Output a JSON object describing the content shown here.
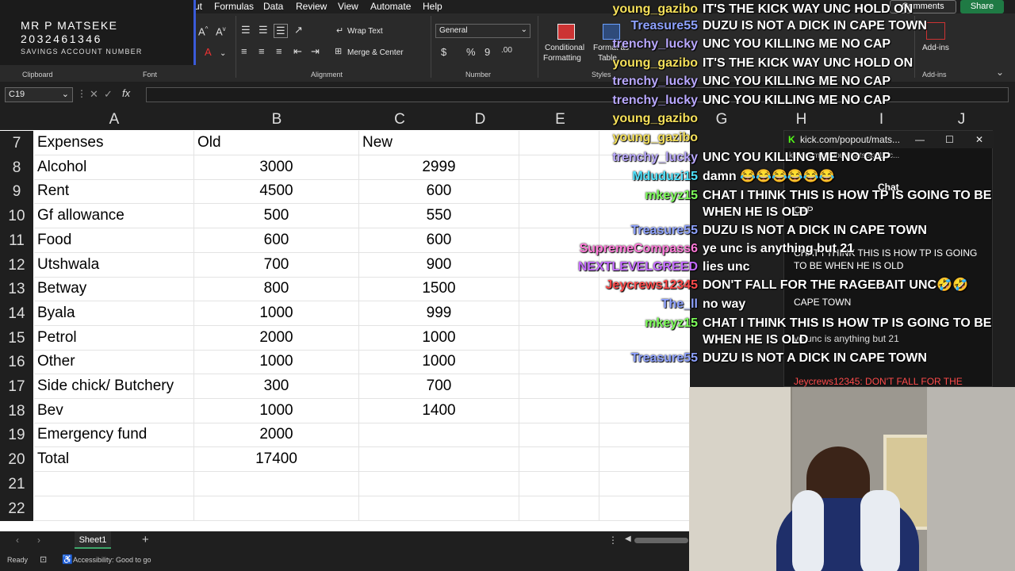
{
  "account": {
    "name": "MR P MATSEKE",
    "number": "2032461346",
    "label": "SAVINGS ACCOUNT NUMBER"
  },
  "menu": [
    "ut",
    "Formulas",
    "Data",
    "Review",
    "View",
    "Automate",
    "Help"
  ],
  "topright": {
    "comments": "Comments",
    "share": "Share"
  },
  "ribbon": {
    "wrap_text": "Wrap Text",
    "merge_center": "Merge & Center",
    "number_format": "General",
    "conditional": "Conditional",
    "formatting": "Formatting",
    "format_as": "Format as",
    "table": "Table",
    "addins": "Add-ins",
    "groups": {
      "clipboard": "Clipboard",
      "font": "Font",
      "alignment": "Alignment",
      "number": "Number",
      "styles": "Styles",
      "addins": "Add-ins"
    }
  },
  "formula_bar": {
    "name_box": "C19",
    "fx": "fx",
    "value": ""
  },
  "columns": [
    "A",
    "B",
    "C",
    "D",
    "E"
  ],
  "rows": [
    {
      "n": "7",
      "a": "Expenses",
      "b": "Old",
      "c": "New",
      "hdr": true
    },
    {
      "n": "8",
      "a": "Alcohol",
      "b": "3000",
      "c": "2999"
    },
    {
      "n": "9",
      "a": "Rent",
      "b": "4500",
      "c": "600"
    },
    {
      "n": "10",
      "a": "Gf allowance",
      "b": "500",
      "c": "550"
    },
    {
      "n": "11",
      "a": "Food",
      "b": "600",
      "c": "600"
    },
    {
      "n": "12",
      "a": "Utshwala",
      "b": "700",
      "c": "900"
    },
    {
      "n": "13",
      "a": "Betway",
      "b": "800",
      "c": "1500"
    },
    {
      "n": "14",
      "a": "Byala",
      "b": "1000",
      "c": "999"
    },
    {
      "n": "15",
      "a": "Petrol",
      "b": "2000",
      "c": "1000"
    },
    {
      "n": "16",
      "a": "Other",
      "b": "1000",
      "c": "1000"
    },
    {
      "n": "17",
      "a": "Side chick/ Butchery",
      "b": "300",
      "c": "700"
    },
    {
      "n": "18",
      "a": "Bev",
      "b": "1000",
      "c": "1400"
    },
    {
      "n": "19",
      "a": "Emergency fund",
      "b": "2000",
      "c": ""
    },
    {
      "n": "20",
      "a": "Total",
      "b": "17400",
      "c": ""
    },
    {
      "n": "21",
      "a": "",
      "b": "",
      "c": ""
    },
    {
      "n": "22",
      "a": "",
      "b": "",
      "c": ""
    }
  ],
  "right_columns": [
    "G",
    "H",
    "I",
    "J"
  ],
  "sheet_tab": "Sheet1",
  "status": {
    "ready": "Ready",
    "accessibility": "Accessibility: Good to go"
  },
  "chat": [
    {
      "user": "young_gazibo",
      "color": "#f5e05a",
      "msg": "IT'S THE KICK WAY UNC HOLD ON"
    },
    {
      "user": "Treasure55",
      "color": "#8ea2ff",
      "msg": "DUZU IS NOT A DICK IN CAPE TOWN"
    },
    {
      "user": "trenchy_lucky",
      "color": "#b9a8ff",
      "msg": "UNC YOU KILLING ME NO CAP"
    },
    {
      "user": "young_gazibo",
      "color": "#f5e05a",
      "msg": "IT'S THE KICK WAY UNC HOLD ON"
    },
    {
      "user": "trenchy_lucky",
      "color": "#b9a8ff",
      "msg": "UNC YOU KILLING ME NO CAP"
    },
    {
      "user": "trenchy_lucky",
      "color": "#b9a8ff",
      "msg": "UNC YOU KILLING ME NO CAP"
    },
    {
      "user": "young_gazibo",
      "color": "#f5e05a",
      "msg": ""
    },
    {
      "user": "young_gazibo",
      "color": "#f5e05a",
      "msg": ""
    },
    {
      "user": "trenchy_lucky",
      "color": "#b9a8ff",
      "msg": "UNC YOU KILLING ME NO CAP"
    },
    {
      "user": "Mduduzi15",
      "color": "#4fe3ff",
      "msg": "damn 😂😂😂😂😂😂"
    },
    {
      "user": "mkeyz15",
      "color": "#7dff5a",
      "msg": "CHAT I THINK THIS IS HOW TP IS GOING TO BE"
    },
    {
      "user": "",
      "color": "#ffffff",
      "msg": "WHEN HE IS OLD"
    },
    {
      "user": "Treasure55",
      "color": "#8ea2ff",
      "msg": "DUZU IS NOT A DICK IN CAPE TOWN"
    },
    {
      "user": "SupremeCompass6",
      "color": "#ff7ad9",
      "msg": "ye unc is anything but 21"
    },
    {
      "user": "NEXTLEVELGREED",
      "color": "#c46bff",
      "msg": "lies unc"
    },
    {
      "user": "Jeycrews12345",
      "color": "#ff4b4b",
      "msg": "DON'T FALL FOR THE RAGEBAIT UNC🤣🤣"
    },
    {
      "user": "The_ll",
      "color": "#8ea2ff",
      "msg": "no way"
    },
    {
      "user": "mkeyz15",
      "color": "#7dff5a",
      "msg": "CHAT I THINK THIS IS HOW TP IS GOING TO BE"
    },
    {
      "user": "",
      "color": "#ffffff",
      "msg": "WHEN HE IS OLD"
    },
    {
      "user": "Treasure55",
      "color": "#8ea2ff",
      "msg": "DUZU IS NOT A DICK IN CAPE TOWN"
    }
  ],
  "popout": {
    "title": "kick.com/popout/mats...",
    "url": "kick.com/popout/matseke11/c...",
    "chat_label": "Chat",
    "messages": [
      "CAP",
      "CHAT I THINK THIS IS HOW TP IS GOING TO BE WHEN HE IS OLD",
      "CAPE TOWN",
      "ye unc is anything but 21",
      "Jeycrews12345: DON'T FALL FOR THE"
    ]
  }
}
